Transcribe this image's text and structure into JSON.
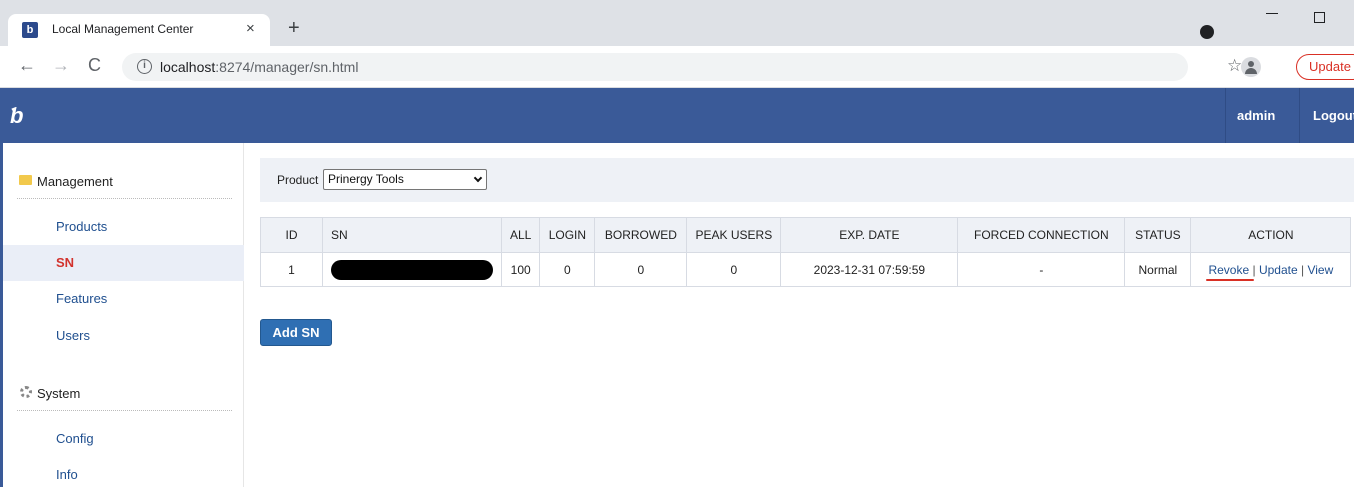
{
  "browser": {
    "tab_title": "Local Management Center",
    "tab_close": "×",
    "new_tab": "+",
    "url_host": "localhost",
    "url_rest": ":8274/manager/sn.html",
    "update_label": "Update"
  },
  "header": {
    "logo": "ʮ",
    "user": "admin",
    "logout": "Logout"
  },
  "sidebar": {
    "groups": [
      {
        "label": "Management",
        "icon": "folder-icon"
      },
      {
        "label": "System",
        "icon": "gear-icon"
      }
    ],
    "items": [
      {
        "label": "Products",
        "active": false
      },
      {
        "label": "SN",
        "active": true
      },
      {
        "label": "Features",
        "active": false
      },
      {
        "label": "Users",
        "active": false
      },
      {
        "label": "Config",
        "active": false
      },
      {
        "label": "Info",
        "active": false
      }
    ]
  },
  "filter": {
    "label": "Product",
    "selected": "Prinergy Tools"
  },
  "table": {
    "headers": [
      "ID",
      "SN",
      "ALL",
      "LOGIN",
      "BORROWED",
      "PEAK USERS",
      "EXP. DATE",
      "FORCED CONNECTION",
      "STATUS",
      "ACTION"
    ],
    "rows": [
      {
        "id": "1",
        "all": "100",
        "login": "0",
        "borrowed": "0",
        "peak_users": "0",
        "exp_date": "2023-12-31 07:59:59",
        "forced_connection": "-",
        "status": "Normal",
        "actions": [
          "Revoke",
          "Update",
          "View"
        ]
      }
    ]
  },
  "actions_separator": "|",
  "add_button": "Add SN"
}
